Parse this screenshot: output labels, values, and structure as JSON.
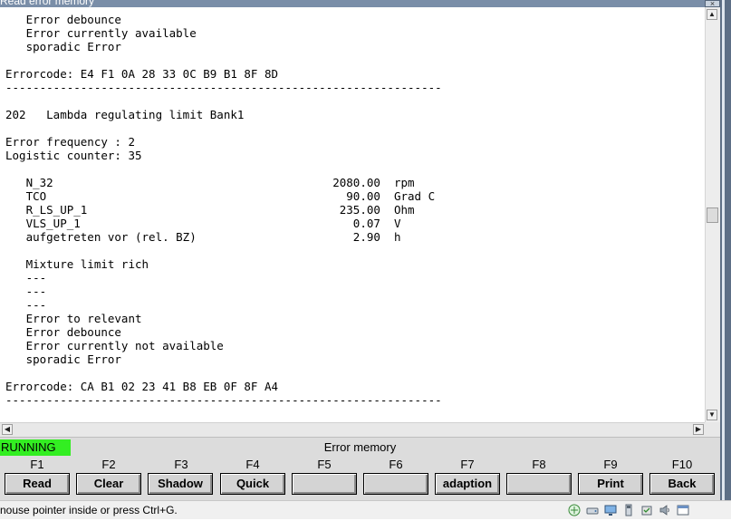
{
  "window": {
    "title": "Read error memory",
    "close_glyph": "×"
  },
  "content_lines": [
    "   Error debounce",
    "   Error currently available",
    "   sporadic Error",
    "",
    "Errorcode: E4 F1 0A 28 33 0C B9 B1 8F 8D",
    "----------------------------------------------------------------",
    "",
    "202   Lambda regulating limit Bank1",
    "",
    "Error frequency : 2",
    "Logistic counter: 35",
    "",
    "   N_32                                         2080.00  rpm",
    "   TCO                                            90.00  Grad C",
    "   R_LS_UP_1                                     235.00  Ohm",
    "   VLS_UP_1                                        0.07  V",
    "   aufgetreten vor (rel. BZ)                       2.90  h",
    "",
    "   Mixture limit rich",
    "   ---",
    "   ---",
    "   ---",
    "   Error to relevant",
    "   Error debounce",
    "   Error currently not available",
    "   sporadic Error",
    "",
    "Errorcode: CA B1 02 23 41 B8 EB 0F 8F A4",
    "----------------------------------------------------------------"
  ],
  "scrollbar": {
    "up": "▲",
    "down": "▼",
    "left": "◀",
    "right": "▶"
  },
  "panel": {
    "status": "RUNNING",
    "title": "Error memory",
    "status_color": "#33ee22"
  },
  "fkeys": [
    {
      "key": "F1",
      "label": "Read"
    },
    {
      "key": "F2",
      "label": "Clear"
    },
    {
      "key": "F3",
      "label": "Shadow"
    },
    {
      "key": "F4",
      "label": "Quick"
    },
    {
      "key": "F5",
      "label": ""
    },
    {
      "key": "F6",
      "label": ""
    },
    {
      "key": "F7",
      "label": "adaption"
    },
    {
      "key": "F8",
      "label": ""
    },
    {
      "key": "F9",
      "label": "Print"
    },
    {
      "key": "F10",
      "label": "Back"
    }
  ],
  "statusbar": {
    "text": "nouse pointer inside or press Ctrl+G."
  },
  "tray_icons": [
    "network-icon",
    "drive-icon",
    "monitor-icon",
    "usb-icon",
    "shield-icon",
    "speaker-icon",
    "window-icon"
  ]
}
